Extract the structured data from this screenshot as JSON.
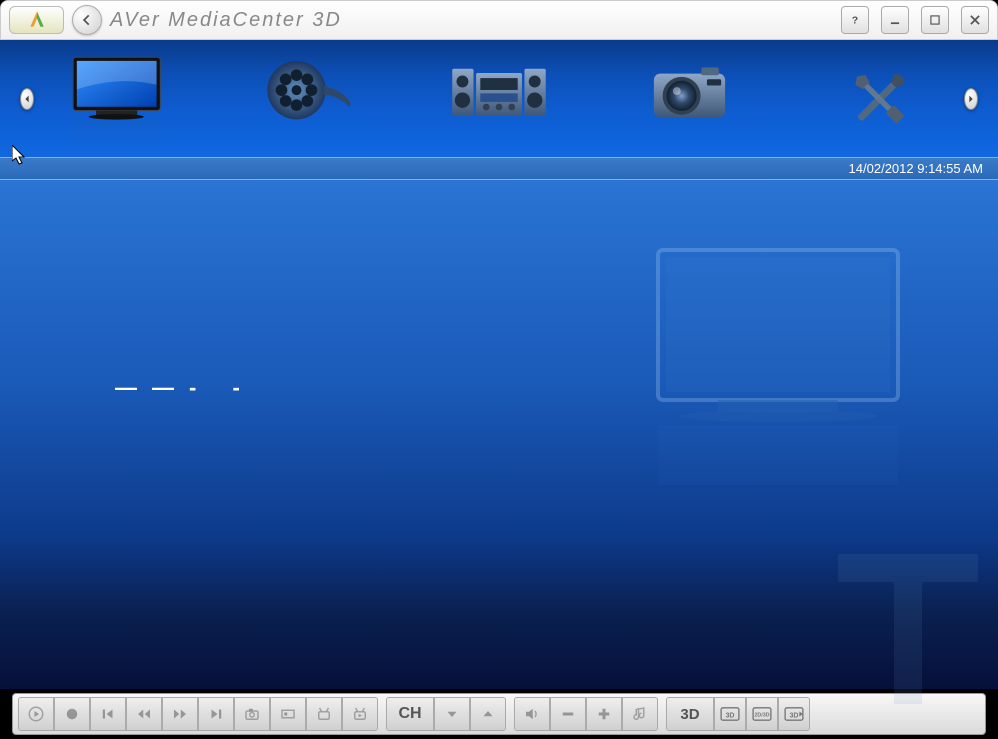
{
  "titlebar": {
    "app_title": "AVer MediaCenter 3D"
  },
  "datebar": {
    "timestamp": "14/02/2012 9:14:55 AM"
  },
  "content": {
    "dashes": "——-   -"
  },
  "toolbar": {
    "ch_label": "CH",
    "three_d_label": "3D",
    "three_d_sub1": "3D",
    "three_d_sub2": "2D/3D",
    "three_d_sub3": "3D"
  },
  "nav": {
    "items": [
      "tv",
      "video",
      "music",
      "pictures",
      "settings"
    ]
  }
}
